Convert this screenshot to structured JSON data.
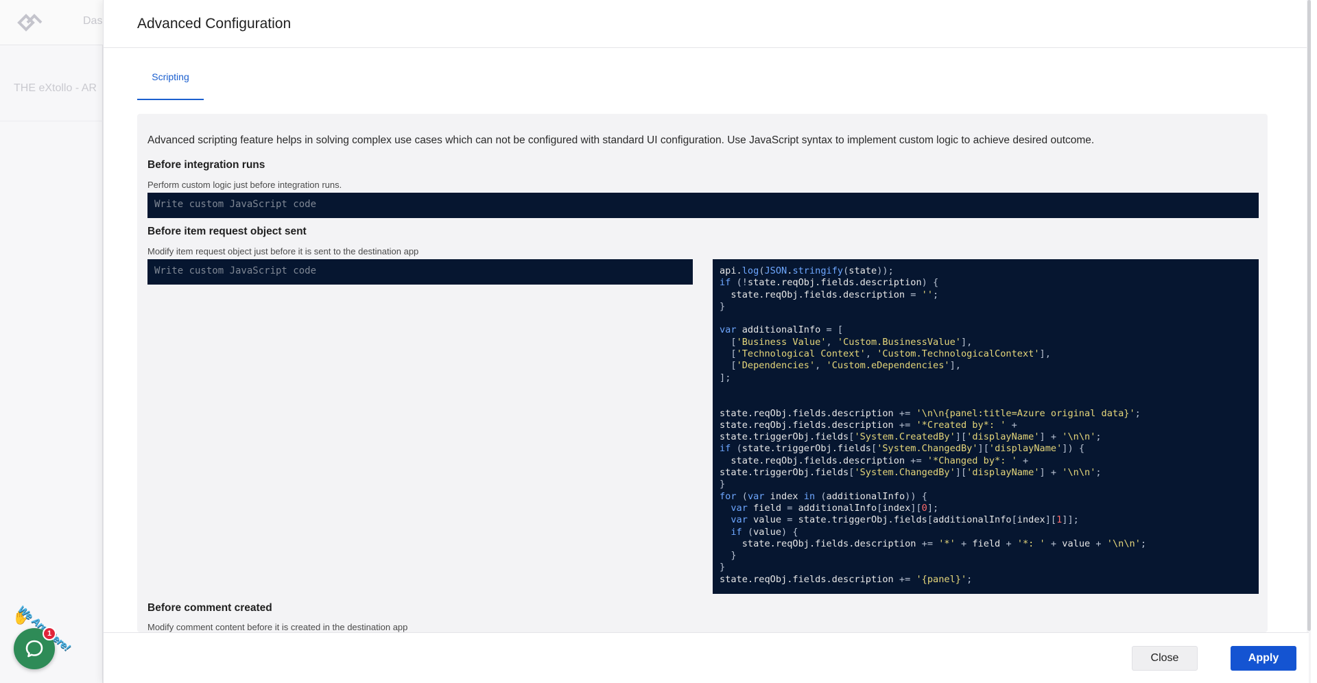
{
  "background": {
    "nav_label": "Das",
    "integration_title": "THE eXtollo - AR"
  },
  "modal": {
    "title": "Advanced Configuration",
    "tabs": [
      {
        "label": "Scripting",
        "active": true
      }
    ]
  },
  "scripting": {
    "intro": "Advanced scripting feature helps in solving complex use cases which can not be configured with standard UI configuration. Use JavaScript syntax to implement custom logic to achieve desired outcome.",
    "sections": [
      {
        "title": "Before integration runs",
        "description": "Perform custom logic just before integration runs.",
        "placeholder": "Write custom JavaScript code"
      },
      {
        "title": "Before item request object sent",
        "description": "Modify item request object just before it is sent to the destination app",
        "placeholder": "Write custom JavaScript code"
      },
      {
        "title": "Before comment created",
        "description": "Modify comment content before it is created in the destination app"
      }
    ],
    "code_lines": [
      "api.log(JSON.stringify(state));",
      "if (!state.reqObj.fields.description) {",
      "  state.reqObj.fields.description = '';",
      "}",
      "",
      "var additionalInfo = [",
      "  ['Business Value', 'Custom.BusinessValue'],",
      "  ['Technological Context', 'Custom.TechnologicalContext'],",
      "  ['Dependencies', 'Custom.eDependencies'],",
      "];",
      "",
      "",
      "state.reqObj.fields.description += '\\n\\n{panel:title=Azure original data}';",
      "state.reqObj.fields.description += '*Created by*: ' +",
      "state.triggerObj.fields['System.CreatedBy']['displayName'] + '\\n\\n';",
      "if (state.triggerObj.fields['System.ChangedBy']['displayName']) {",
      "  state.reqObj.fields.description += '*Changed by*: ' +",
      "state.triggerObj.fields['System.ChangedBy']['displayName'] + '\\n\\n';",
      "}",
      "for (var index in (additionalInfo)) {",
      "  var field = additionalInfo[index][0];",
      "  var value = state.triggerObj.fields[additionalInfo[index][1]];",
      "  if (value) {",
      "    state.reqObj.fields.description += '*' + field + '*: ' + value + '\\n\\n';",
      "  }",
      "}",
      "state.reqObj.fields.description += '{panel}';"
    ]
  },
  "footer": {
    "close_label": "Close",
    "apply_label": "Apply"
  },
  "chat_widget": {
    "sign_text": "We Are Here!",
    "badge_count": "1"
  },
  "colors": {
    "accent": "#1454d2",
    "editor_bg": "#061630",
    "panel_bg": "#f3f3f5"
  }
}
